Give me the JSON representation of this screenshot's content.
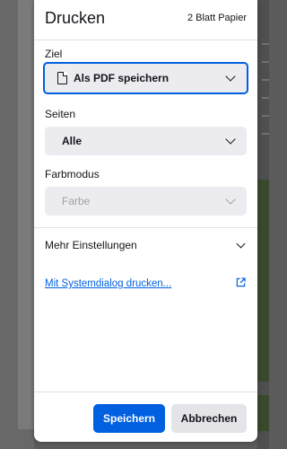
{
  "dialog": {
    "title": "Drucken",
    "sheet_count": "2 Blatt Papier"
  },
  "destination": {
    "label": "Ziel",
    "value": "Als PDF speichern",
    "icon": "document-icon"
  },
  "pages": {
    "label": "Seiten",
    "value": "Alle"
  },
  "color_mode": {
    "label": "Farbmodus",
    "value": "Farbe"
  },
  "more_settings": {
    "label": "Mehr Einstellungen"
  },
  "system_dialog": {
    "link": "Mit Systemdialog drucken..."
  },
  "buttons": {
    "save": "Speichern",
    "cancel": "Abbrechen"
  },
  "colors": {
    "accent": "#0060df",
    "dialog_bg": "#ffffff",
    "select_bg": "#ececf0"
  }
}
